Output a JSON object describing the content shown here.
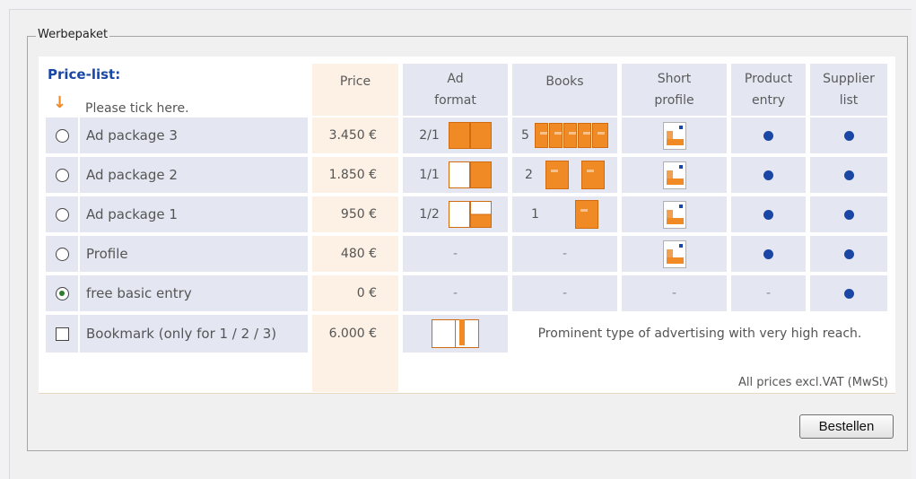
{
  "fieldset": {
    "legend": "Werbepaket"
  },
  "header": {
    "title": "Price-list:",
    "instruction": "Please tick here.",
    "arrow_icon": "down-arrow-icon",
    "columns": {
      "price": "Price",
      "ad_format_1": "Ad",
      "ad_format_2": "format",
      "books": "Books",
      "short_profile_1": "Short",
      "short_profile_2": "profile",
      "product_entry_1": "Product",
      "product_entry_2": "entry",
      "supplier_list_1": "Supplier",
      "supplier_list_2": "list"
    }
  },
  "rows": [
    {
      "label": "Ad package 3",
      "price": "3.450 €",
      "ad_format": "2/1",
      "books_count": "5",
      "selected": false
    },
    {
      "label": "Ad package 2",
      "price": "1.850 €",
      "ad_format": "1/1",
      "books_count": "2",
      "selected": false
    },
    {
      "label": "Ad package 1",
      "price": "950 €",
      "ad_format": "1/2",
      "books_count": "1",
      "selected": false
    },
    {
      "label": "Profile",
      "price": "480 €",
      "ad_format": "-",
      "books_count": "-",
      "selected": false
    },
    {
      "label": "free basic entry",
      "price": "0 €",
      "ad_format": "-",
      "books_count": "-",
      "short_profile": "-",
      "product_entry": "-",
      "selected": true
    }
  ],
  "bookmark": {
    "label": "Bookmark (only for 1 / 2 / 3)",
    "price": "6.000 €",
    "description": "Prominent type of advertising with very high reach.",
    "checked": false
  },
  "footer": {
    "note": "All prices excl.VAT (MwSt)"
  },
  "actions": {
    "order_label": "Bestellen"
  },
  "colors": {
    "accent": "#ef8a24",
    "dot": "#1a47a5",
    "row_bg": "#e4e7f2",
    "price_bg": "#fcf1e4"
  }
}
